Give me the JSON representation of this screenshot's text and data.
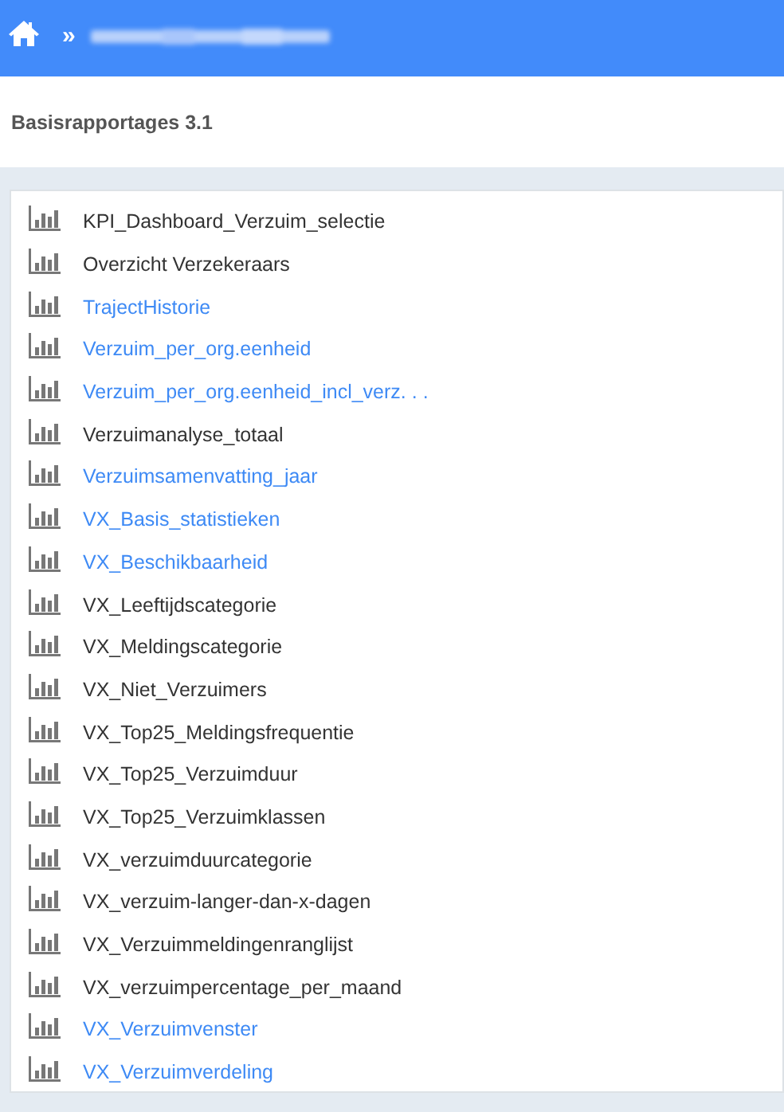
{
  "header": {
    "separator": "»"
  },
  "page_title": "Basisrapportages 3.1",
  "reports": [
    {
      "label": "KPI_Dashboard_Verzuim_selectie",
      "visited": false
    },
    {
      "label": "Overzicht Verzekeraars",
      "visited": false
    },
    {
      "label": "TrajectHistorie",
      "visited": true
    },
    {
      "label": "Verzuim_per_org.eenheid",
      "visited": true
    },
    {
      "label": "Verzuim_per_org.eenheid_incl_verz. . .",
      "visited": true
    },
    {
      "label": "Verzuimanalyse_totaal",
      "visited": false
    },
    {
      "label": "Verzuimsamenvatting_jaar",
      "visited": true
    },
    {
      "label": "VX_Basis_statistieken",
      "visited": true
    },
    {
      "label": "VX_Beschikbaarheid",
      "visited": true
    },
    {
      "label": "VX_Leeftijdscategorie",
      "visited": false
    },
    {
      "label": "VX_Meldingscategorie",
      "visited": false
    },
    {
      "label": "VX_Niet_Verzuimers",
      "visited": false
    },
    {
      "label": "VX_Top25_Meldingsfrequentie",
      "visited": false
    },
    {
      "label": "VX_Top25_Verzuimduur",
      "visited": false
    },
    {
      "label": "VX_Top25_Verzuimklassen",
      "visited": false
    },
    {
      "label": "VX_verzuimduurcategorie",
      "visited": false
    },
    {
      "label": "VX_verzuim-langer-dan-x-dagen",
      "visited": false
    },
    {
      "label": "VX_Verzuimmeldingenranglijst",
      "visited": false
    },
    {
      "label": "VX_verzuimpercentage_per_maand",
      "visited": false
    },
    {
      "label": "VX_Verzuimvenster",
      "visited": true
    },
    {
      "label": "VX_Verzuimverdeling",
      "visited": true
    }
  ]
}
